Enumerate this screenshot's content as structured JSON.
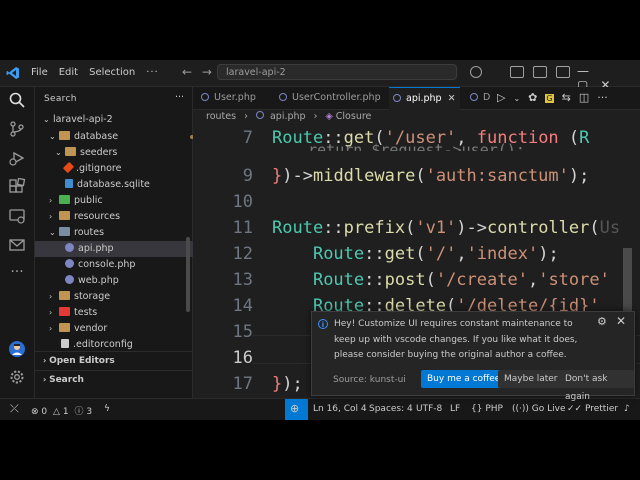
{
  "menu": {
    "file": "File",
    "edit": "Edit",
    "selection": "Selection",
    "more": "···"
  },
  "command_center": "laravel-api-2",
  "explorer": {
    "search_label": "Search",
    "root": "laravel-api-2",
    "items": [
      {
        "label": "database"
      },
      {
        "label": "seeders"
      },
      {
        "label": ".gitignore"
      },
      {
        "label": "database.sqlite"
      },
      {
        "label": "public"
      },
      {
        "label": "resources"
      },
      {
        "label": "routes"
      },
      {
        "label": "api.php"
      },
      {
        "label": "console.php"
      },
      {
        "label": "web.php"
      },
      {
        "label": "storage"
      },
      {
        "label": "tests"
      },
      {
        "label": "vendor"
      },
      {
        "label": ".editorconfig"
      }
    ],
    "open_editors": "Open Editors",
    "search_section": "Search"
  },
  "tabs": [
    {
      "label": "User.php"
    },
    {
      "label": "UserController.php"
    },
    {
      "label": "api.php"
    },
    {
      "label": "D"
    }
  ],
  "breadcrumb": {
    "folder": "routes",
    "file": "api.php",
    "symbol": "Closure"
  },
  "code": {
    "lines": [
      "7",
      "8",
      "9",
      "10",
      "11",
      "12",
      "13",
      "14",
      "15",
      "16",
      "17"
    ]
  },
  "notification": {
    "message": "Hey! Customize UI requires constant maintenance to keep up with vscode changes. If you like what it does, please consider buying the original author a coffee.",
    "source": "Source: kunst-ui",
    "buy": "Buy me a coffee",
    "later": "Maybe later",
    "never": "Don't ask again"
  },
  "status": {
    "errors": "0",
    "warnings": "1",
    "info": "3",
    "position": "Ln 16, Col 4",
    "spaces": "Spaces: 4",
    "encoding": "UTF-8",
    "eol": "LF",
    "language": "PHP",
    "golive": "Go Live",
    "prettier": "Prettier"
  },
  "colors": {
    "accent": "#0078d4"
  }
}
